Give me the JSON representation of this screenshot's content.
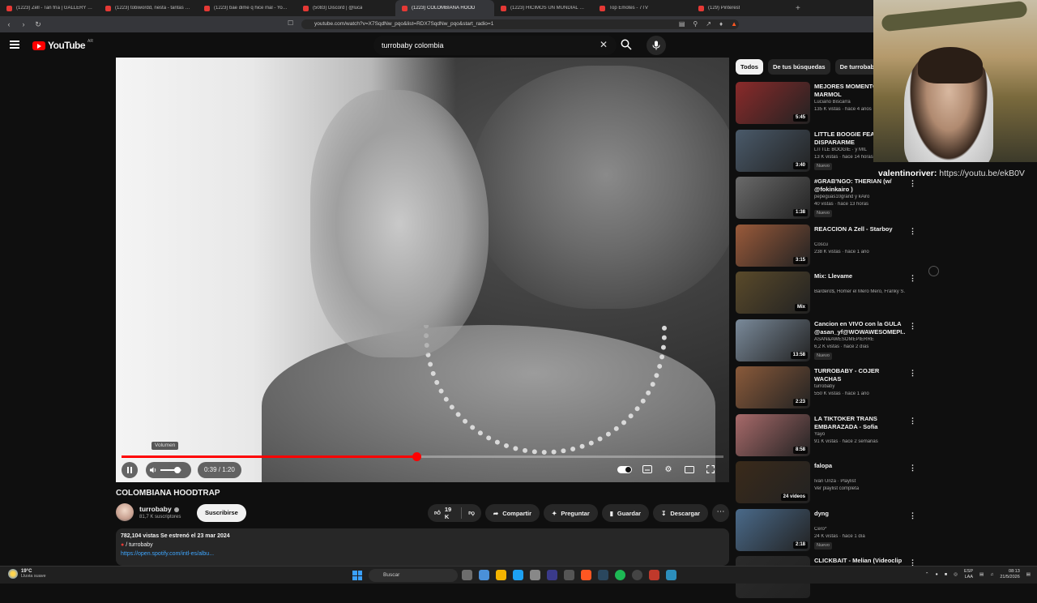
{
  "browser": {
    "tabs": [
      {
        "title": "(1223) Zell - Tan fría | GALLERY SESSI",
        "active": false
      },
      {
        "title": "(1223) tobiwordd, nesta - tantas vue",
        "active": false
      },
      {
        "title": "(1223) bae dime q hice mal - YouTub",
        "active": false
      },
      {
        "title": "(5083) Discord | @luca",
        "active": false
      },
      {
        "title": "(1223) COLOMBIANA HOOD",
        "active": true
      },
      {
        "title": "(1223) HICIMOS UN MUNDIAL CON",
        "active": false
      },
      {
        "title": "Top Emotes - 7TV",
        "active": false
      },
      {
        "title": "(129) Pinterest",
        "active": false
      }
    ],
    "url": "youtube.com/watch?v=X7SqdNw_pqo&list=RDX7SqdNw_pqo&start_radio=1"
  },
  "youtube": {
    "logo_text": "YouTube",
    "region": "AR",
    "search_query": "turrobaby colombia"
  },
  "player": {
    "volume_tooltip": "Volumen",
    "time": "0:39 / 1:20",
    "progress_fraction": 0.49,
    "volume_fraction": 0.8
  },
  "video": {
    "title": "COLOMBIANA HOODTRAP",
    "channel": "turrobaby",
    "subscribers": "81,7 K suscriptores",
    "subscribe_label": "Suscribirse",
    "likes": "19 K",
    "share_label": "Compartir",
    "ask_label": "Preguntar",
    "save_label": "Guardar",
    "download_label": "Descargar",
    "description": {
      "stats": "782,104 vistas  Se estrenó el 23 mar 2024",
      "line": "/ turrobaby",
      "link": "https://open.spotify.com/intl-es/albu..."
    }
  },
  "chips": [
    {
      "label": "Todos",
      "selected": true
    },
    {
      "label": "De tus búsquedas",
      "selected": false
    },
    {
      "label": "De turrobaby",
      "selected": false
    }
  ],
  "recommendations": [
    {
      "title": "MEJORES MOMENTOS MARMOL",
      "channel": "Luciano Biscarra",
      "meta": "135 K vistas · hace 4 años",
      "duration": "5:45",
      "badge": "",
      "thumb": "#8b2a2a"
    },
    {
      "title": "LITTLE BOOGIE FEAT VOY A DISPARARME",
      "channel": "LITTLE BOOGIE · y MIL",
      "meta": "13 K vistas · hace 14 horas",
      "duration": "3:40",
      "badge": "Nuevo",
      "thumb": "#4a5a6a"
    },
    {
      "title": "#GRAB'NGO: THERIAN (w/ @fokinkairo )",
      "channel": "pepeguas10grand y kAirō",
      "meta": "40 vistas · hace 13 horas",
      "duration": "1:38",
      "badge": "Nuevo",
      "thumb": "#6a6a6a"
    },
    {
      "title": "REACCION A Zell - Starboy",
      "channel": "Coscu",
      "meta": "238 K vistas · hace 1 año",
      "duration": "3:15",
      "badge": "",
      "thumb": "#9a5a3a"
    },
    {
      "title": "Mix: Llevame",
      "channel": "Bardero$, Homer el Mero Mero, Franky S...",
      "meta": "",
      "duration": "Mix",
      "badge": "",
      "thumb": "#5a4a2a"
    },
    {
      "title": "Cancion en VIVO con la GULA @asan_yf@WOWAWESOMEPI...",
      "channel": "ASAN&AWESOMEPIERRE",
      "meta": "6,2 K vistas · hace 2 días",
      "duration": "13:58",
      "badge": "Nuevo",
      "thumb": "#7a8a9a"
    },
    {
      "title": "TURROBABY - COJER WACHAS",
      "channel": "turrobaby",
      "meta": "550 K vistas · hace 1 año",
      "duration": "2:23",
      "badge": "",
      "thumb": "#8a5a3a"
    },
    {
      "title": "LA TIKTOKER TRANS EMBARAZADA - Sofia Agustina",
      "channel": "Yayo",
      "meta": "91 K vistas · hace 2 semanas",
      "duration": "8:58",
      "badge": "",
      "thumb": "#a86a6a"
    },
    {
      "title": "falopa",
      "channel": "Ivan Uriza · Playlist",
      "meta": "Ver playlist completa",
      "duration": "24 videos",
      "badge": "",
      "thumb": "#3a2a1a"
    },
    {
      "title": "dyng",
      "channel": "Cero*",
      "meta": "24 K vistas · hace 1 día",
      "duration": "2:18",
      "badge": "Nuevo",
      "thumb": "#4a6a8a"
    },
    {
      "title": "CLICKBAIT - Melian (Videoclip",
      "channel": "",
      "meta": "",
      "duration": "",
      "badge": "",
      "thumb": "#2a2a2a"
    }
  ],
  "stream_chat": {
    "user": "valentinoriver:",
    "message": "https://youtu.be/ekB0V"
  },
  "taskbar": {
    "temp": "19°C",
    "weather": "Lluvia suave",
    "search_label": "Buscar",
    "lang": "ESP",
    "lang2": "LAA",
    "time": "08:13",
    "date": "21/5/2026"
  }
}
